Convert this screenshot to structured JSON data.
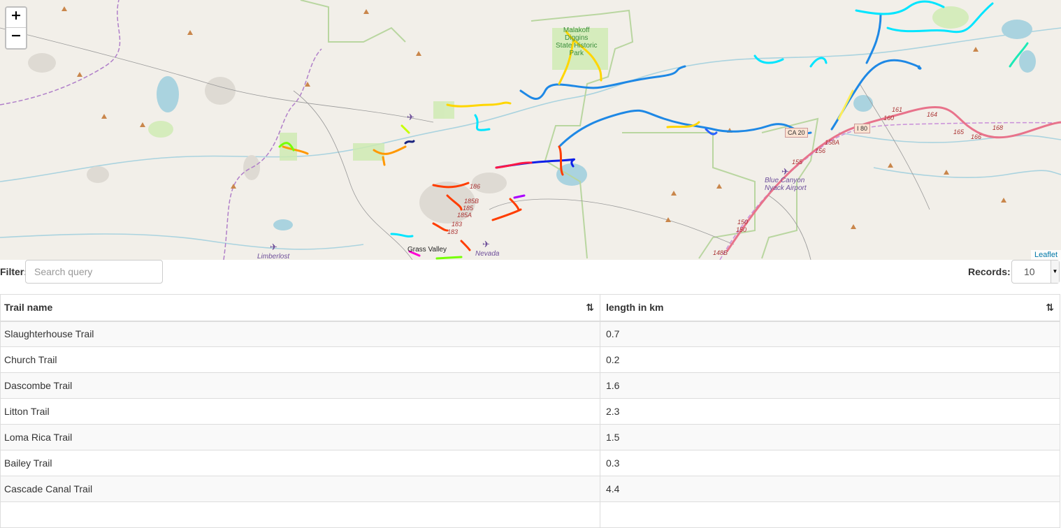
{
  "map": {
    "zoom_in_label": "+",
    "zoom_out_label": "−",
    "attribution": "Leaflet",
    "labels": {
      "park": "Malakoff\nDiggins\nState Historic\nPark",
      "grass_valley": "Grass Valley",
      "nevada": "Nevada",
      "limberlost": "Limberlost",
      "airport": "Blue Canyon\nNyack Airport",
      "ca20": "CA 20",
      "i80": "I 80"
    },
    "road_numbers": [
      "186",
      "185B",
      "185",
      "185A",
      "183",
      "183",
      "161",
      "160",
      "164",
      "165",
      "166",
      "168",
      "155",
      "156",
      "158A",
      "150",
      "150",
      "148B"
    ]
  },
  "toolbar": {
    "filter_label": "Filter:",
    "search_placeholder": "Search query",
    "records_label": "Records:",
    "records_value": "10"
  },
  "table": {
    "columns": [
      "Trail name",
      "length in km"
    ],
    "rows": [
      {
        "name": "Slaughterhouse Trail",
        "length": "0.7"
      },
      {
        "name": "Church Trail",
        "length": "0.2"
      },
      {
        "name": "Dascombe Trail",
        "length": "1.6"
      },
      {
        "name": "Litton Trail",
        "length": "2.3"
      },
      {
        "name": "Loma Rica Trail",
        "length": "1.5"
      },
      {
        "name": "Bailey Trail",
        "length": "0.3"
      },
      {
        "name": "Cascade Canal Trail",
        "length": "4.4"
      },
      {
        "name": "",
        "length": ""
      }
    ]
  },
  "colors": {
    "map_background": "#f2efe9",
    "water": "#aad3df",
    "park_boundary": "#b9d6a0",
    "highway": "#e8738b"
  }
}
